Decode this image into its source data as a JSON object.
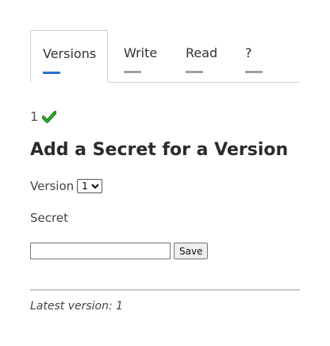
{
  "tabs": [
    {
      "label": "Versions",
      "active": true
    },
    {
      "label": "Write",
      "active": false
    },
    {
      "label": "Read",
      "active": false
    },
    {
      "label": "?",
      "active": false
    }
  ],
  "versions_list": {
    "items": [
      {
        "number": "1",
        "status_icon": "check-icon"
      }
    ]
  },
  "main": {
    "title": "Add a Secret for a Version",
    "version_label": "Version",
    "version_selected": "1",
    "secret_label": "Secret",
    "secret_value": "",
    "save_label": "Save"
  },
  "footer": {
    "latest_version_text": "Latest version: 1"
  },
  "colors": {
    "active_indicator": "#2f6fd3",
    "inactive_indicator": "#a0a0a0",
    "check": "#1a9a1a"
  }
}
